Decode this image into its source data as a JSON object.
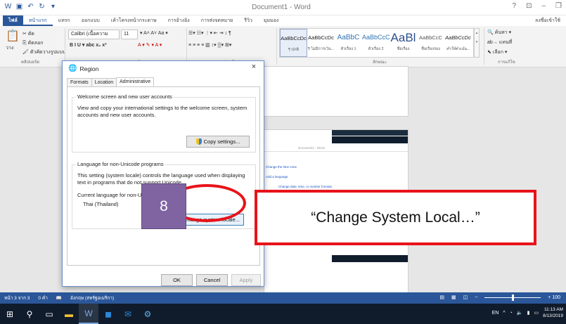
{
  "word": {
    "doc_title": "Document1 - Word",
    "tabs": [
      "ไฟล์",
      "หน้าแรก",
      "แทรก",
      "ออกแบบ",
      "เค้าโครงหน้ากระดาษ",
      "การอ้างอิง",
      "การส่งจดหมาย",
      "รีวิว",
      "มุมมอง"
    ],
    "share_label": "ลงชื่อเข้าใช้",
    "clipboard": {
      "paste": "วาง",
      "cut": "ตัด",
      "copy": "คัดลอก",
      "format_painter": "ตัวคัดวางรูปแบบ",
      "group": "คลิปบอร์ด"
    },
    "font": {
      "name": "Calibri (เนื้อความ",
      "size": "11",
      "group": "แบบอักษร"
    },
    "paragraph_group": "ย่อหน้า",
    "styles": [
      {
        "sample": "AaBbCcDc",
        "name": "¶ ปกติ"
      },
      {
        "sample": "AaBbCcDc",
        "name": "¶ ไม่มีการเว้น..."
      },
      {
        "sample": "AaBbC",
        "name": "หัวเรื่อง 1"
      },
      {
        "sample": "AaBbCcC",
        "name": "หัวเรื่อง 2"
      },
      {
        "sample": "AaBl",
        "name": "ชื่อเรื่อง"
      },
      {
        "sample": "AaBbCcC",
        "name": "ชื่อเรื่องรอง"
      },
      {
        "sample": "AaBbCcDc",
        "name": "ทำให้ตัวเน้น..."
      }
    ],
    "styles_group": "ลักษณะ",
    "editing": {
      "find": "ค้นหา",
      "replace": "แทนที่",
      "select": "เลือก",
      "group": "การแก้ไข"
    },
    "status": {
      "page": "หน้า 3 จาก 3",
      "words": "0 คำ",
      "language": "อังกฤษ (สหรัฐอเมริกา)"
    },
    "zoom": "+ 100",
    "zoom_level": 0.5
  },
  "mini_screen": {
    "title": "Document1 - Word",
    "link_lines": [
      "Change the time zone",
      "Add a language",
      "Change date, time, or number formats"
    ]
  },
  "dialog": {
    "title": "Region",
    "close": "×",
    "tabs": [
      "Formats",
      "Location",
      "Administrative"
    ],
    "welcome": {
      "legend": "Welcome screen and new user accounts",
      "text": "View and copy your international settings to the welcome screen, system accounts and new user accounts.",
      "button": "Copy settings..."
    },
    "nonunicode": {
      "legend": "Language for non-Unicode programs",
      "text": "This setting (system locale) controls the language used when displaying text in programs that do not support Unicode.",
      "current_label": "Current language for non-Unicode programs:",
      "current_value": "Thai (Thailand)",
      "button": "Change system locale..."
    },
    "ok": "OK",
    "cancel": "Cancel",
    "apply": "Apply"
  },
  "annotation": {
    "step": "8",
    "callout": "“Change System Local…”",
    "accent": "#e8131a",
    "badge_color": "#8064a2"
  },
  "taskbar": {
    "lang": "EN",
    "time": "11:13 AM",
    "date": "8/13/2019"
  }
}
